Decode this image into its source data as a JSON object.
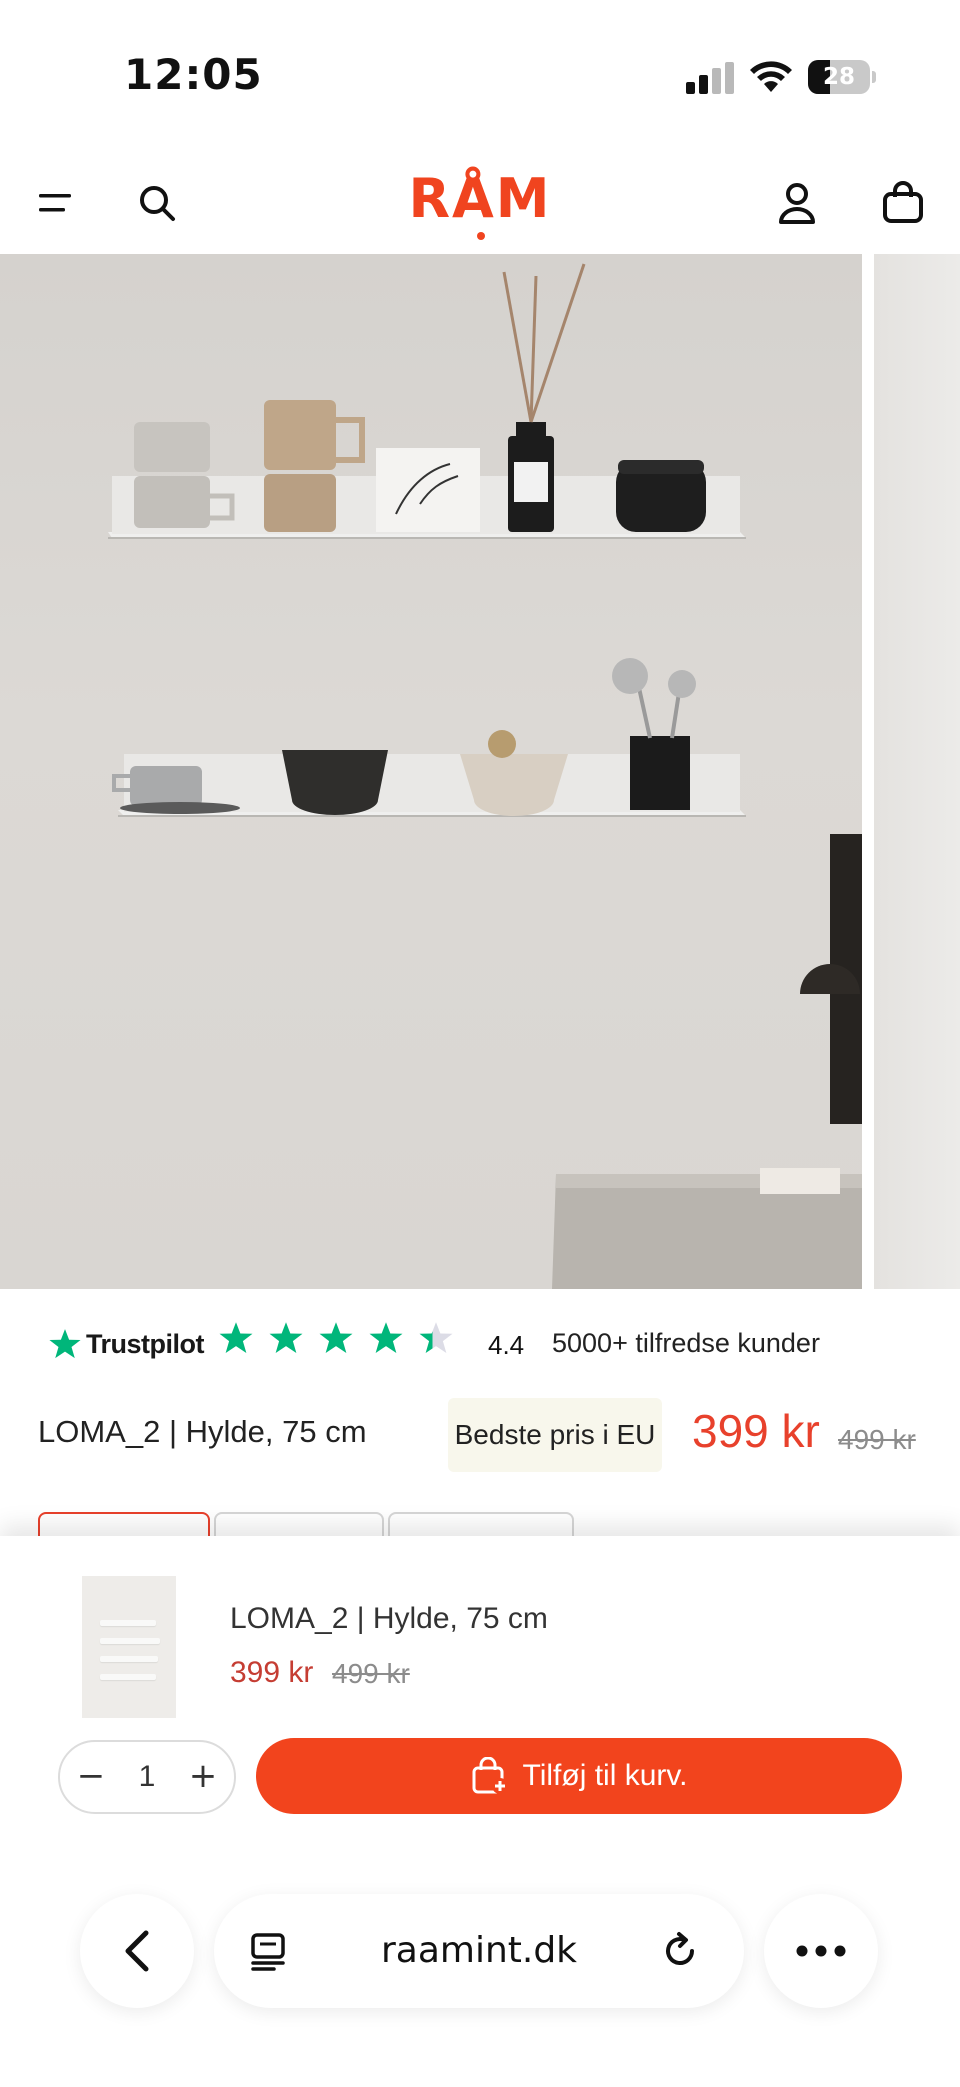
{
  "status_bar": {
    "time": "12:05",
    "battery_level": "28",
    "icons": [
      "cellular-signal-icon",
      "wifi-icon",
      "battery-icon"
    ]
  },
  "header": {
    "logo_text": "RÅM",
    "icons": [
      "menu-icon",
      "search-icon",
      "account-icon",
      "bag-icon"
    ],
    "brand_color": "#f0441f"
  },
  "gallery": {
    "slides_visible": 2
  },
  "rating": {
    "provider": "Trustpilot",
    "stars": 4.4,
    "score": "4.4",
    "text": "5000+ tilfredse kunder",
    "star_color": "#00b67a"
  },
  "product": {
    "title": "LOMA_2 | Hylde, 75 cm",
    "badge": "Bedste pris i EU",
    "price": "399 kr",
    "old_price": "499 kr",
    "price_color": "#e8412c"
  },
  "sticky_bar": {
    "title": "LOMA_2 | Hylde, 75 cm",
    "price": "399 kr",
    "old_price": "499 kr",
    "quantity": "1",
    "qty_minus": "−",
    "qty_plus": "+",
    "add_to_cart_label": "Tilføj til kurv.",
    "button_color": "#f2441d"
  },
  "browser": {
    "url": "raamint.dk",
    "icons": [
      "back-icon",
      "tabs-icon",
      "reload-icon",
      "more-icon"
    ]
  }
}
